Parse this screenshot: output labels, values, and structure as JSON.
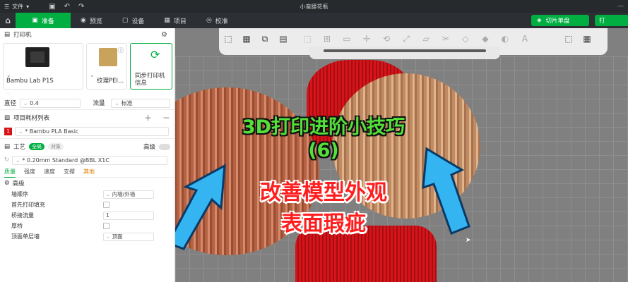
{
  "titlebar": {
    "file_menu": "文件",
    "app_title": "小蛮腰花瓶",
    "icons": [
      "save-icon",
      "undo-icon",
      "redo-icon"
    ]
  },
  "toolbar": {
    "tabs": [
      {
        "label": "准备",
        "icon": "box-icon"
      },
      {
        "label": "预览",
        "icon": "eye-icon"
      },
      {
        "label": "设备",
        "icon": "device-icon"
      },
      {
        "label": "项目",
        "icon": "grid-icon"
      },
      {
        "label": "校准",
        "icon": "target-icon"
      }
    ],
    "slice_label": "切片单盘",
    "print_label": "打"
  },
  "panel": {
    "printer_section": "打印机",
    "printer_name": "Bambu Lab P1S",
    "plate_name": "纹理PEI...",
    "sync_label": "同步打印机信息",
    "nozzle_label": "直径",
    "nozzle_value": "0.4",
    "flow_label": "流量",
    "flow_value": "标准",
    "filament_section": "项目耗材列表",
    "filament_index": "1",
    "filament_value": "* Bambu PLA Basic",
    "process_section": "工艺",
    "process_badge_all": "全局",
    "process_badge_obj": "对象",
    "advanced_toggle": "高级",
    "process_value": "* 0.20mm Standard @BBL X1C",
    "subtabs": [
      "质量",
      "强度",
      "速度",
      "支撑",
      "其他"
    ],
    "group_title": "高级",
    "rows": [
      {
        "label": "墙顺序",
        "control": "select",
        "value": "内墙/外墙"
      },
      {
        "label": "首先打印填充",
        "control": "checkbox",
        "value": ""
      },
      {
        "label": "桥接流量",
        "control": "input",
        "value": "1"
      },
      {
        "label": "厚桥",
        "control": "checkbox",
        "value": ""
      },
      {
        "label": "顶面单层墙",
        "control": "select",
        "value": "顶面"
      }
    ]
  },
  "overlay": {
    "line1": "3D打印进阶小技巧",
    "line2": "(6)",
    "line3": "改善模型外观",
    "line4": "表面瑕疵"
  },
  "colors": {
    "accent": "#00ae42",
    "model_red": "#d7141a",
    "overlay_green": "#53e03a",
    "overlay_red": "#ff1e1e"
  }
}
